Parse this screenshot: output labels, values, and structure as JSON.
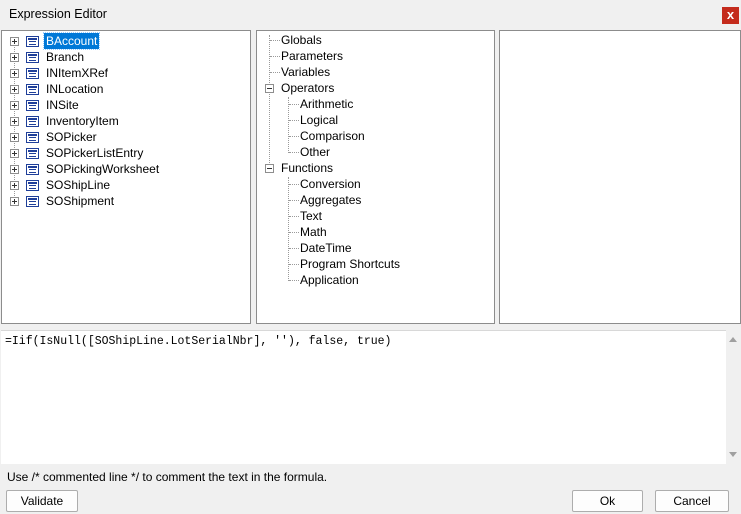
{
  "window": {
    "title": "Expression Editor",
    "close_glyph": "x"
  },
  "fields_tree": {
    "items": [
      {
        "label": "BAccount",
        "selected": true
      },
      {
        "label": "Branch"
      },
      {
        "label": "INItemXRef"
      },
      {
        "label": "INLocation"
      },
      {
        "label": "INSite"
      },
      {
        "label": "InventoryItem"
      },
      {
        "label": "SOPicker"
      },
      {
        "label": "SOPickerListEntry"
      },
      {
        "label": "SOPickingWorksheet"
      },
      {
        "label": "SOShipLine"
      },
      {
        "label": "SOShipment"
      }
    ]
  },
  "category_tree": {
    "globals": "Globals",
    "parameters": "Parameters",
    "variables": "Variables",
    "operators": {
      "label": "Operators",
      "children": [
        "Arithmetic",
        "Logical",
        "Comparison",
        "Other"
      ]
    },
    "functions": {
      "label": "Functions",
      "children": [
        "Conversion",
        "Aggregates",
        "Text",
        "Math",
        "DateTime",
        "Program Shortcuts",
        "Application"
      ]
    }
  },
  "formula": {
    "value": "=Iif(IsNull([SOShipLine.LotSerialNbr], ''), false, true)"
  },
  "hint": "Use /* commented line */ to comment the text in the formula.",
  "buttons": {
    "validate": "Validate",
    "ok": "Ok",
    "cancel": "Cancel"
  },
  "colors": {
    "selection": "#0078d7",
    "close_button": "#c42b1c",
    "table_icon": "#1f3f99"
  }
}
